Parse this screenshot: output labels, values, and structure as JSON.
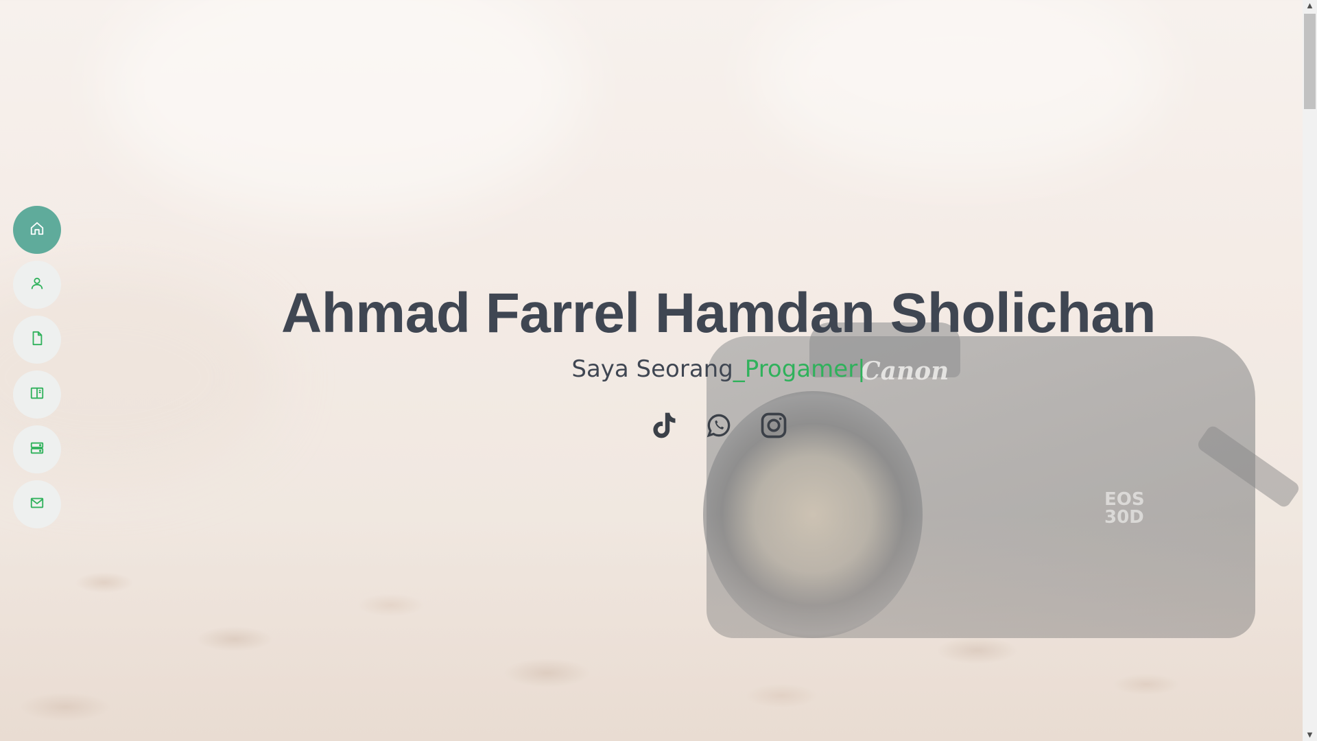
{
  "hero": {
    "name": "Ahmad Farrel Hamdan Sholichan",
    "subtitle_prefix": "Saya Seorang",
    "subtitle_typed": "_Progamer|"
  },
  "background": {
    "camera_brand": "Canon",
    "camera_model": "EOS\n30D"
  },
  "nav": {
    "items": [
      {
        "icon": "home-icon",
        "active": true
      },
      {
        "icon": "person-icon",
        "active": false
      },
      {
        "icon": "file-icon",
        "active": false
      },
      {
        "icon": "book-icon",
        "active": false
      },
      {
        "icon": "server-icon",
        "active": false
      },
      {
        "icon": "envelope-icon",
        "active": false
      }
    ]
  },
  "socials": [
    "tiktok-icon",
    "whatsapp-icon",
    "instagram-icon"
  ],
  "colors": {
    "accent": "#2fb15b",
    "nav_active": "#5fab9b",
    "text": "#3f4652"
  }
}
